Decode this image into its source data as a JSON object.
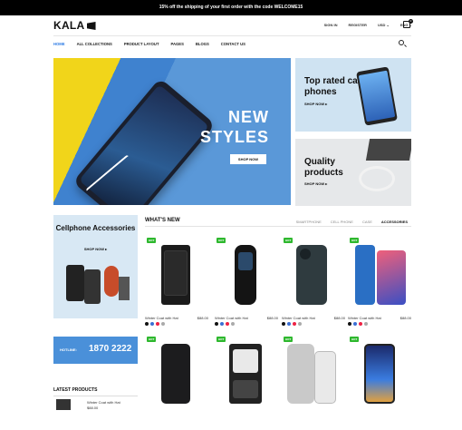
{
  "promo": {
    "text": "15% off the shipping of your first order with the code WELCOME15"
  },
  "header": {
    "logo": "KALA",
    "sign_in": "SIGN IN",
    "register": "REGISTER",
    "currency": "USD ⌄",
    "language": "ENG ⌄",
    "cart_count": "0"
  },
  "nav": {
    "items": [
      "HOME",
      "ALL COLLECTIONS",
      "PRODUCT LAYOUT",
      "PAGES",
      "BLOGS",
      "CONTACT US"
    ]
  },
  "hero": {
    "title": "NEW STYLES",
    "button": "SHOP NOW"
  },
  "side_banners": [
    {
      "title": "Top rated call phones",
      "link": "SHOP NOW ▸"
    },
    {
      "title": "Quality products",
      "link": "SHOP NOW ▸"
    }
  ],
  "accessories": {
    "title": "Cellphone Accessories",
    "link": "SHOP NOW ▸"
  },
  "hotline": {
    "label": "HOTLINE:",
    "number": "1870 2222"
  },
  "latest": {
    "title": "LATEST PRODUCTS",
    "item_name": "Winter Coat with Hat",
    "item_price": "$88.00"
  },
  "whats_new": {
    "title": "WHAT'S NEW",
    "tabs": [
      "SMARTPHONE",
      "CELL PHONE",
      "CASE",
      "ACCESSORIES"
    ],
    "products": [
      {
        "badge": "HOT",
        "name": "Winter Coat with Hat",
        "price": "$88.00"
      },
      {
        "badge": "HOT",
        "name": "Winter Coat with Hat",
        "price": "$88.00"
      },
      {
        "badge": "HOT",
        "name": "Winter Coat with Hat",
        "price": "$88.00"
      },
      {
        "badge": "HOT",
        "name": "Winter Coat with Hat",
        "price": "$88.00"
      },
      {
        "badge": "HOT",
        "name": "",
        "price": ""
      },
      {
        "badge": "HOT",
        "name": "",
        "price": ""
      },
      {
        "badge": "HOT",
        "name": "",
        "price": ""
      },
      {
        "badge": "HOT",
        "name": "",
        "price": ""
      }
    ]
  },
  "colors": {
    "accent": "#2d7be5",
    "hot_badge": "#2eb82e",
    "hotline_bg": "#4a90d9"
  }
}
